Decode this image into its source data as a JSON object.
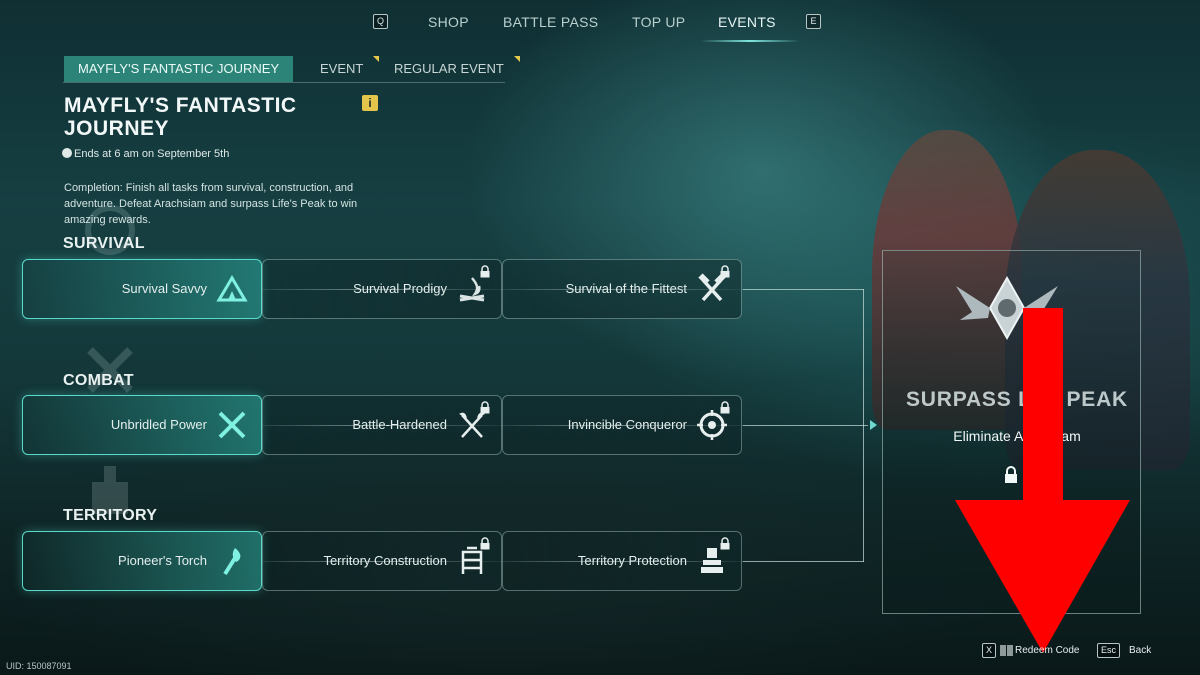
{
  "topnav": {
    "left_key": "Q",
    "right_key": "E",
    "tabs": [
      "SHOP",
      "BATTLE PASS",
      "TOP UP",
      "EVENTS"
    ],
    "active_tab": "EVENTS"
  },
  "subtabs": [
    {
      "label": "MAYFLY'S FANTASTIC JOURNEY",
      "active": true,
      "has_flag": false
    },
    {
      "label": "EVENT",
      "active": false,
      "has_flag": true
    },
    {
      "label": "REGULAR EVENT",
      "active": false,
      "has_flag": true
    }
  ],
  "event": {
    "title": "MAYFLY'S FANTASTIC JOURNEY",
    "info_glyph": "i",
    "ends": "Ends at 6 am on September 5th",
    "description": "Completion: Finish all tasks from survival, construction, and adventure. Defeat Arachsiam and surpass Life's Peak to win amazing rewards."
  },
  "sections": [
    {
      "label": "SURVIVAL",
      "tasks": [
        {
          "label": "Survival Savvy",
          "icon": "tent-icon",
          "completed": true,
          "locked": false
        },
        {
          "label": "Survival Prodigy",
          "icon": "campfire-icon",
          "completed": false,
          "locked": true
        },
        {
          "label": "Survival of the Fittest",
          "icon": "crossed-hammers-icon",
          "completed": false,
          "locked": true
        }
      ]
    },
    {
      "label": "COMBAT",
      "tasks": [
        {
          "label": "Unbridled Power",
          "icon": "crossed-blades-icon",
          "completed": true,
          "locked": false
        },
        {
          "label": "Battle-Hardened",
          "icon": "crossed-axes-icon",
          "completed": false,
          "locked": true
        },
        {
          "label": "Invincible Conqueror",
          "icon": "crosshair-icon",
          "completed": false,
          "locked": true
        }
      ]
    },
    {
      "label": "TERRITORY",
      "tasks": [
        {
          "label": "Pioneer's Torch",
          "icon": "torch-icon",
          "completed": true,
          "locked": false
        },
        {
          "label": "Territory Construction",
          "icon": "scaffold-icon",
          "completed": false,
          "locked": true
        },
        {
          "label": "Territory Protection",
          "icon": "turret-icon",
          "completed": false,
          "locked": true
        }
      ]
    }
  ],
  "reward": {
    "title": "SURPASS LI",
    "title_end": "PEAK",
    "subtitle": "Eliminate A",
    "subtitle_end": "am",
    "locked": true
  },
  "footer": {
    "uid": "UID: 150087091",
    "redeem_key": "X",
    "redeem_label": "Redeem Code",
    "back_key": "Esc",
    "back_label": "Back"
  },
  "colors": {
    "accent": "#59d9c9",
    "active_tab_bg": "#2c8478",
    "flag": "#e6c94c",
    "annotation": "#ff0000"
  }
}
